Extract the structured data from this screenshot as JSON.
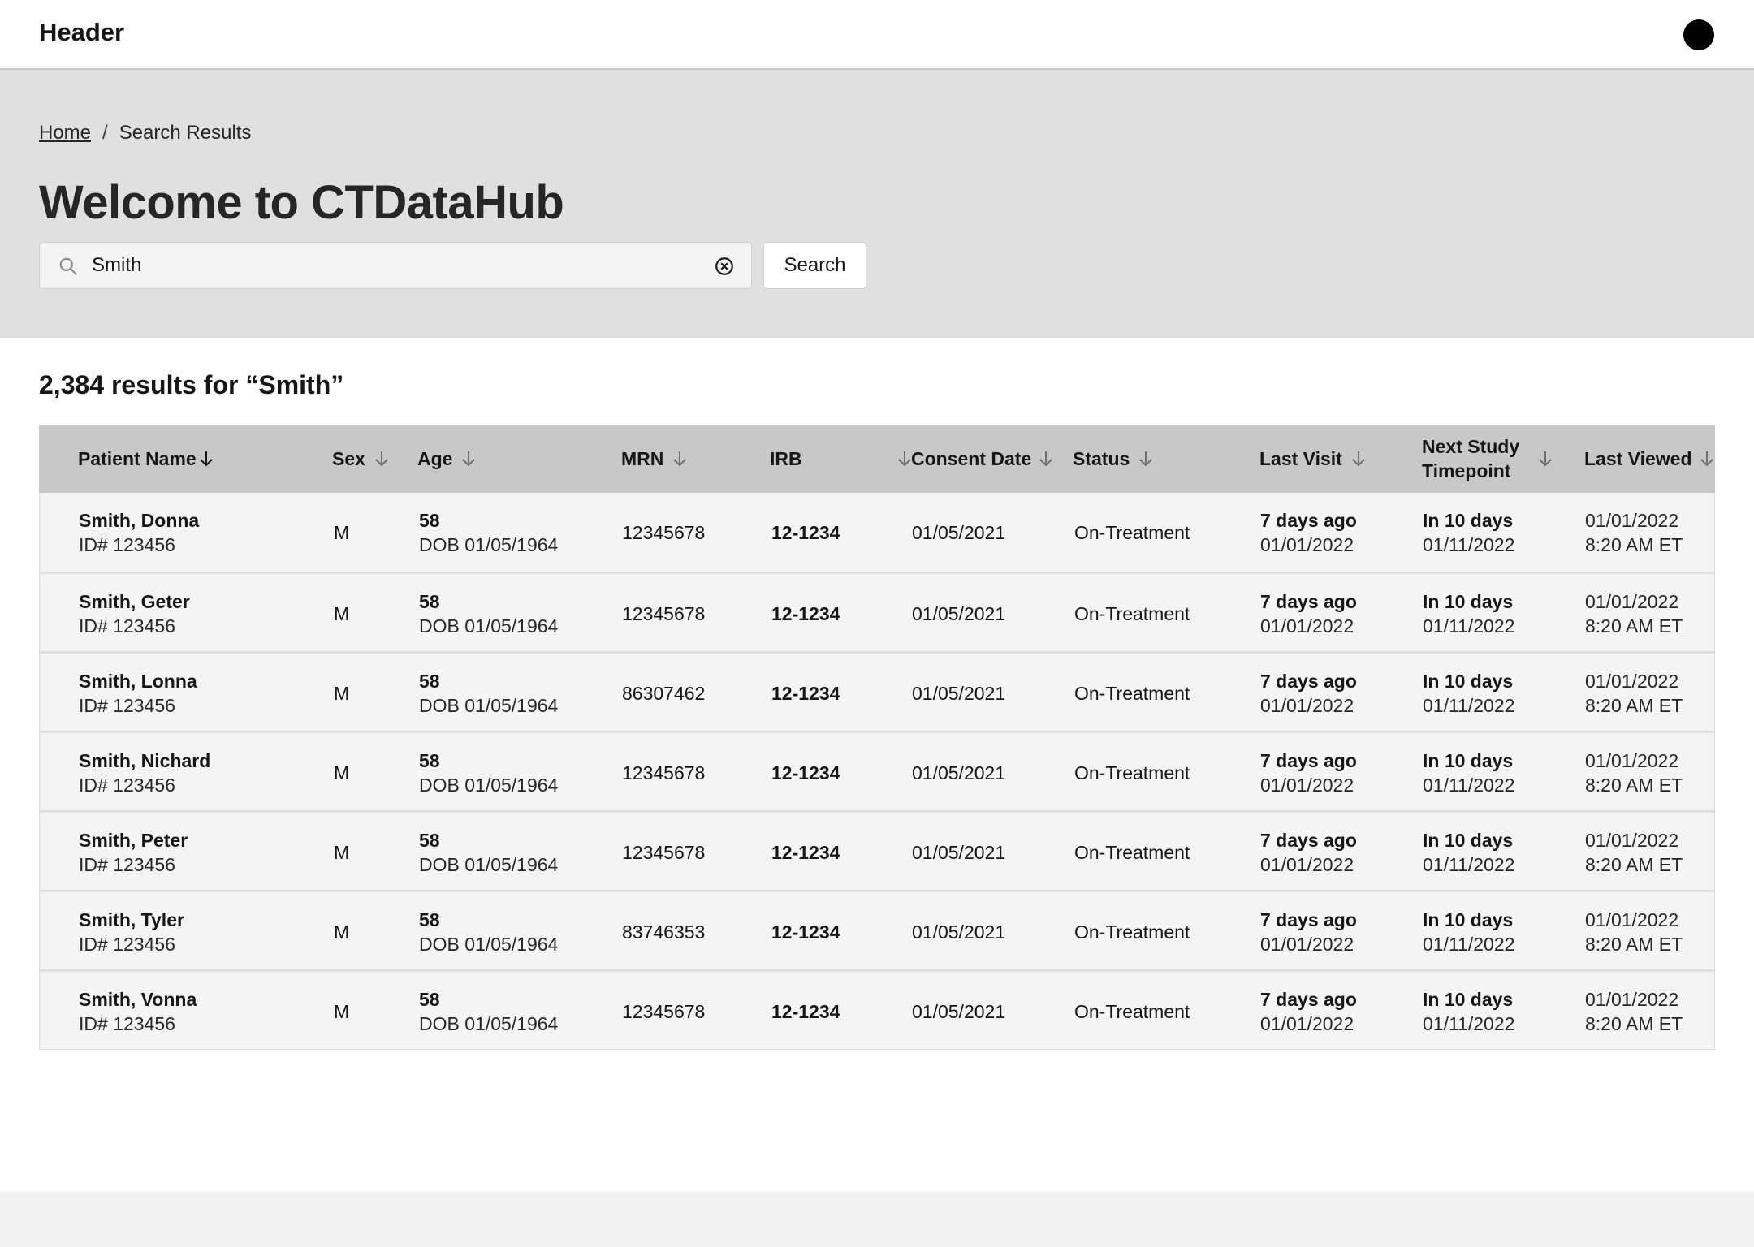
{
  "header": {
    "title": "Header"
  },
  "breadcrumb": {
    "home": "Home",
    "separator": "/",
    "current": "Search Results"
  },
  "hero": {
    "title": "Welcome to CTDataHub"
  },
  "search": {
    "value": "Smith",
    "button_label": "Search"
  },
  "results": {
    "summary": "2,384 results for “Smith”"
  },
  "table": {
    "columns": [
      "Patient Name",
      "Sex",
      "Age",
      "MRN",
      "IRB",
      "Consent Date",
      "Status",
      "Last Visit",
      "Next Study Timepoint",
      "Last Viewed"
    ],
    "rows": [
      {
        "name": "Smith, Donna",
        "id": "ID# 123456",
        "sex": "M",
        "age": "58",
        "dob": "DOB 01/05/1964",
        "mrn": "12345678",
        "irb": "12-1234",
        "consent": "01/05/2021",
        "status": "On-Treatment",
        "last_visit_rel": "7 days ago",
        "last_visit_date": "01/01/2022",
        "next_rel": "In 10 days",
        "next_date": "01/11/2022",
        "viewed_date": "01/01/2022",
        "viewed_time": "8:20 AM ET"
      },
      {
        "name": "Smith, Geter",
        "id": "ID# 123456",
        "sex": "M",
        "age": "58",
        "dob": "DOB 01/05/1964",
        "mrn": "12345678",
        "irb": "12-1234",
        "consent": "01/05/2021",
        "status": "On-Treatment",
        "last_visit_rel": "7 days ago",
        "last_visit_date": "01/01/2022",
        "next_rel": "In 10 days",
        "next_date": "01/11/2022",
        "viewed_date": "01/01/2022",
        "viewed_time": "8:20 AM ET"
      },
      {
        "name": "Smith, Lonna",
        "id": "ID# 123456",
        "sex": "M",
        "age": "58",
        "dob": "DOB 01/05/1964",
        "mrn": "86307462",
        "irb": "12-1234",
        "consent": "01/05/2021",
        "status": "On-Treatment",
        "last_visit_rel": "7 days ago",
        "last_visit_date": "01/01/2022",
        "next_rel": "In 10 days",
        "next_date": "01/11/2022",
        "viewed_date": "01/01/2022",
        "viewed_time": "8:20 AM ET"
      },
      {
        "name": "Smith, Nichard",
        "id": "ID# 123456",
        "sex": "M",
        "age": "58",
        "dob": "DOB 01/05/1964",
        "mrn": "12345678",
        "irb": "12-1234",
        "consent": "01/05/2021",
        "status": "On-Treatment",
        "last_visit_rel": "7 days ago",
        "last_visit_date": "01/01/2022",
        "next_rel": "In 10 days",
        "next_date": "01/11/2022",
        "viewed_date": "01/01/2022",
        "viewed_time": "8:20 AM ET"
      },
      {
        "name": "Smith, Peter",
        "id": "ID# 123456",
        "sex": "M",
        "age": "58",
        "dob": "DOB 01/05/1964",
        "mrn": "12345678",
        "irb": "12-1234",
        "consent": "01/05/2021",
        "status": "On-Treatment",
        "last_visit_rel": "7 days ago",
        "last_visit_date": "01/01/2022",
        "next_rel": "In 10 days",
        "next_date": "01/11/2022",
        "viewed_date": "01/01/2022",
        "viewed_time": "8:20 AM ET"
      },
      {
        "name": "Smith, Tyler",
        "id": "ID# 123456",
        "sex": "M",
        "age": "58",
        "dob": "DOB 01/05/1964",
        "mrn": "83746353",
        "irb": "12-1234",
        "consent": "01/05/2021",
        "status": "On-Treatment",
        "last_visit_rel": "7 days ago",
        "last_visit_date": "01/01/2022",
        "next_rel": "In 10 days",
        "next_date": "01/11/2022",
        "viewed_date": "01/01/2022",
        "viewed_time": "8:20 AM ET"
      },
      {
        "name": "Smith, Vonna",
        "id": "ID# 123456",
        "sex": "M",
        "age": "58",
        "dob": "DOB 01/05/1964",
        "mrn": "12345678",
        "irb": "12-1234",
        "consent": "01/05/2021",
        "status": "On-Treatment",
        "last_visit_rel": "7 days ago",
        "last_visit_date": "01/01/2022",
        "next_rel": "In 10 days",
        "next_date": "01/11/2022",
        "viewed_date": "01/01/2022",
        "viewed_time": "8:20 AM ET"
      }
    ]
  },
  "icons": {
    "search": "search-icon",
    "clear": "clear-circle-icon",
    "sort": "arrow-down-icon",
    "avatar": "avatar"
  },
  "colors": {
    "hero_bg": "#e0e0e0",
    "table_header_bg": "#c8c8c8",
    "row_bg": "#f4f4f4",
    "footer_bg": "#f2f2f2"
  }
}
